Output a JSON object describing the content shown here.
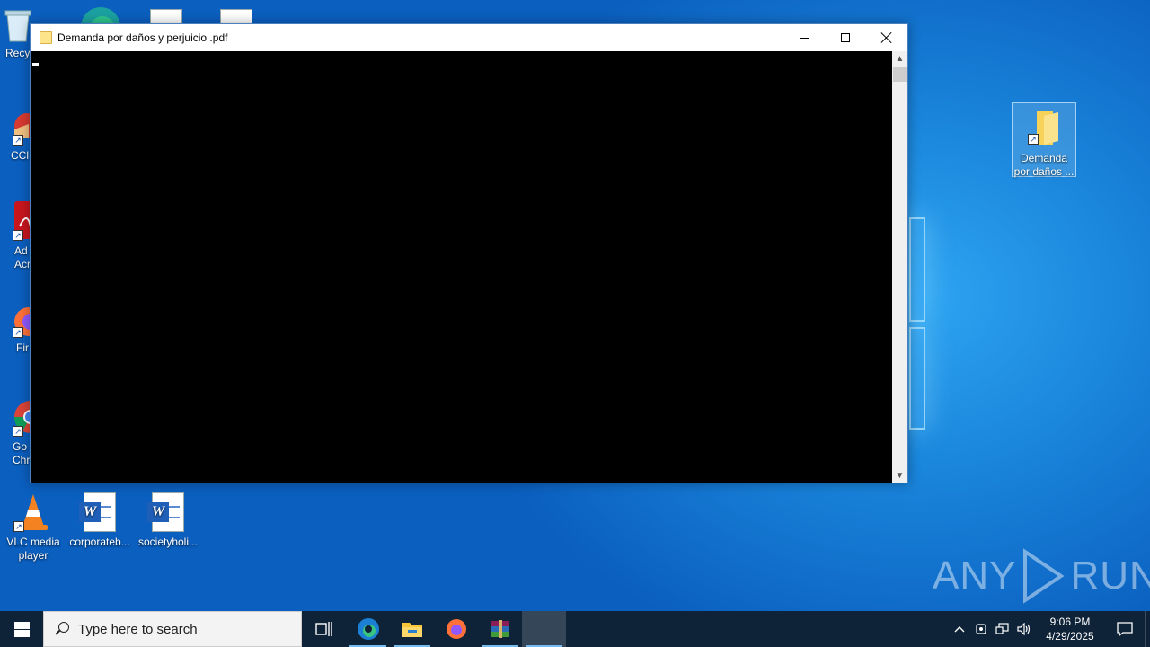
{
  "desktop": {
    "icons": [
      {
        "label": "Recy"
      },
      {
        "label": "CCl"
      },
      {
        "label": "Ad\nAcr"
      },
      {
        "label": "Fir"
      },
      {
        "label": "Go\nChr"
      },
      {
        "label": "VLC media player"
      },
      {
        "label": "corporateb..."
      },
      {
        "label": "societyholi..."
      },
      {
        "label": "Demanda por daños ..."
      }
    ]
  },
  "window": {
    "title": "Demanda por daños y perjuicio .pdf",
    "minimize_icon": "minimize-icon",
    "maximize_icon": "maximize-icon",
    "close_icon": "close-icon"
  },
  "watermark": {
    "left": "ANY",
    "right": "RUN"
  },
  "taskbar": {
    "search_placeholder": "Type here to search",
    "apps": [
      "task-view-icon",
      "edge-icon",
      "file-explorer-icon",
      "firefox-icon",
      "winrar-icon",
      "console-app-icon"
    ],
    "clock_time": "9:06 PM",
    "clock_date": "4/29/2025"
  }
}
